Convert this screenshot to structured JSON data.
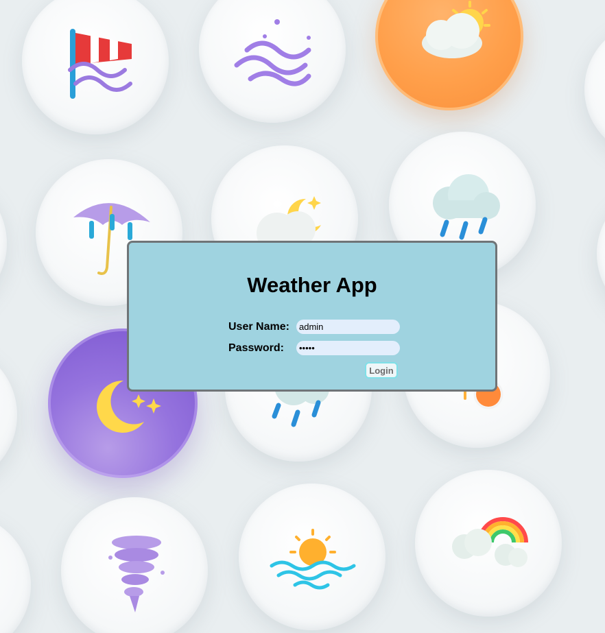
{
  "app": {
    "title": "Weather App"
  },
  "login_form": {
    "username_label": "User Name:",
    "username_value": "admin",
    "password_label": "Password:",
    "password_value": "•••••",
    "login_button_label": "Login"
  },
  "background_icons": [
    "windsock-icon",
    "wind-icon",
    "partly-sunny-icon",
    "umbrella-icon",
    "cloudy-night-icon",
    "rain-cloud-icon",
    "moon-stars-icon",
    "rain-icon",
    "sunset-icon",
    "tornado-icon",
    "sea-sunrise-icon",
    "rainbow-cloud-icon"
  ],
  "colors": {
    "background": "#e9eef0",
    "panel_background": "#9fd3e0",
    "panel_border": "#6f7477",
    "input_background": "#e3eefc",
    "button_border": "#7fe0e8",
    "orange_bubble": "#ff9f4a",
    "purple_bubble": "#8a67d9"
  }
}
